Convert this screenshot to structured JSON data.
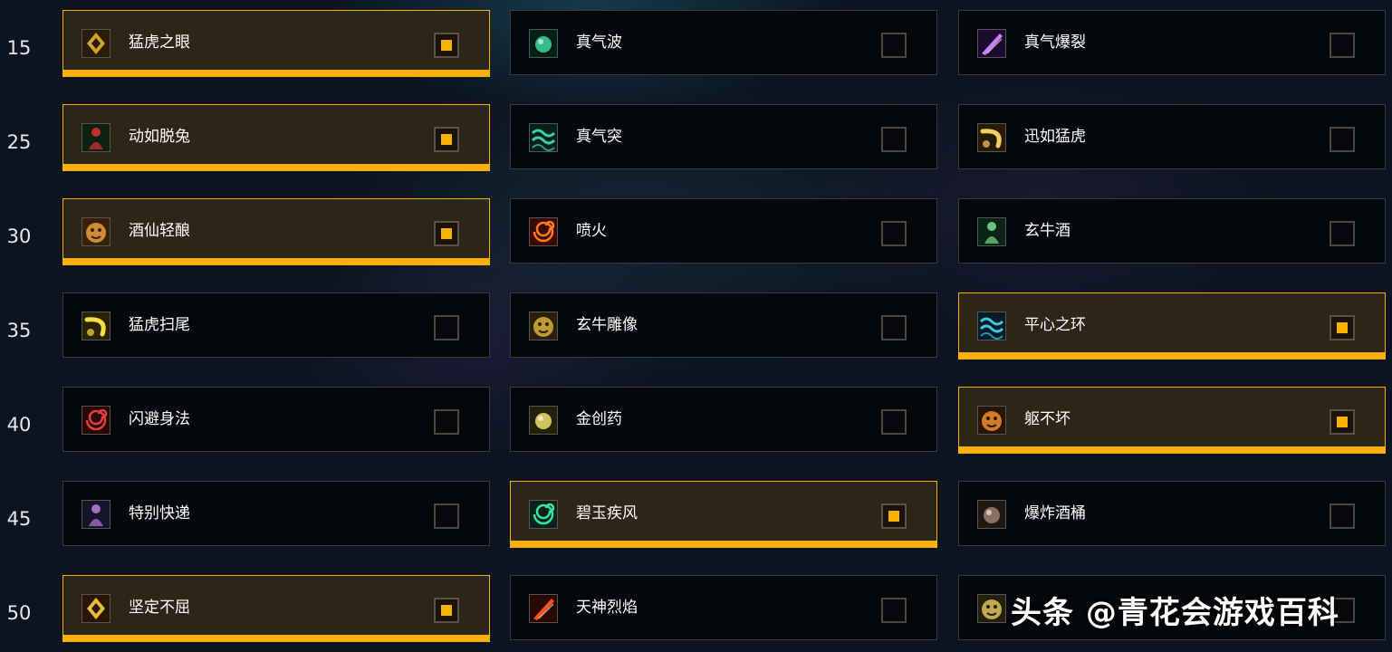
{
  "colors": {
    "accent": "#f8b200",
    "selected_bg": "#2e2518",
    "card_bg": "#05080b"
  },
  "rows": [
    {
      "level": "15",
      "talents": [
        {
          "name": "猛虎之眼",
          "icon": "tiger-eye-icon",
          "selected": true
        },
        {
          "name": "真气波",
          "icon": "chi-wave-icon",
          "selected": false
        },
        {
          "name": "真气爆裂",
          "icon": "chi-burst-icon",
          "selected": false
        }
      ]
    },
    {
      "level": "25",
      "talents": [
        {
          "name": "动如脱兔",
          "icon": "celerity-icon",
          "selected": true
        },
        {
          "name": "真气突",
          "icon": "chi-torpedo-icon",
          "selected": false
        },
        {
          "name": "迅如猛虎",
          "icon": "tigers-lust-icon",
          "selected": false
        }
      ]
    },
    {
      "level": "30",
      "talents": [
        {
          "name": "酒仙轻酿",
          "icon": "light-brewing-icon",
          "selected": true
        },
        {
          "name": "喷火",
          "icon": "spitfire-icon",
          "selected": false
        },
        {
          "name": "玄牛酒",
          "icon": "black-ox-brew-icon",
          "selected": false
        }
      ]
    },
    {
      "level": "35",
      "talents": [
        {
          "name": "猛虎扫尾",
          "icon": "tiger-tail-sweep-icon",
          "selected": false
        },
        {
          "name": "玄牛雕像",
          "icon": "black-ox-statue-icon",
          "selected": false
        },
        {
          "name": "平心之环",
          "icon": "ring-of-peace-icon",
          "selected": true
        }
      ]
    },
    {
      "level": "40",
      "talents": [
        {
          "name": "闪避身法",
          "icon": "bob-and-weave-icon",
          "selected": false
        },
        {
          "name": "金创药",
          "icon": "healing-elixir-icon",
          "selected": false
        },
        {
          "name": "躯不坏",
          "icon": "dampen-harm-icon",
          "selected": true
        }
      ]
    },
    {
      "level": "45",
      "talents": [
        {
          "name": "特别快递",
          "icon": "special-delivery-icon",
          "selected": false
        },
        {
          "name": "碧玉疾风",
          "icon": "rushing-jade-wind-icon",
          "selected": true
        },
        {
          "name": "爆炸酒桶",
          "icon": "exploding-keg-icon",
          "selected": false
        }
      ]
    },
    {
      "level": "50",
      "talents": [
        {
          "name": "坚定不屈",
          "icon": "high-tolerance-icon",
          "selected": true
        },
        {
          "name": "天神烈焰",
          "icon": "celestial-flames-icon",
          "selected": false
        },
        {
          "name": "",
          "icon": "blackout-combo-icon",
          "selected": false
        }
      ]
    }
  ],
  "watermark": "头条 @青花会游戏百科"
}
